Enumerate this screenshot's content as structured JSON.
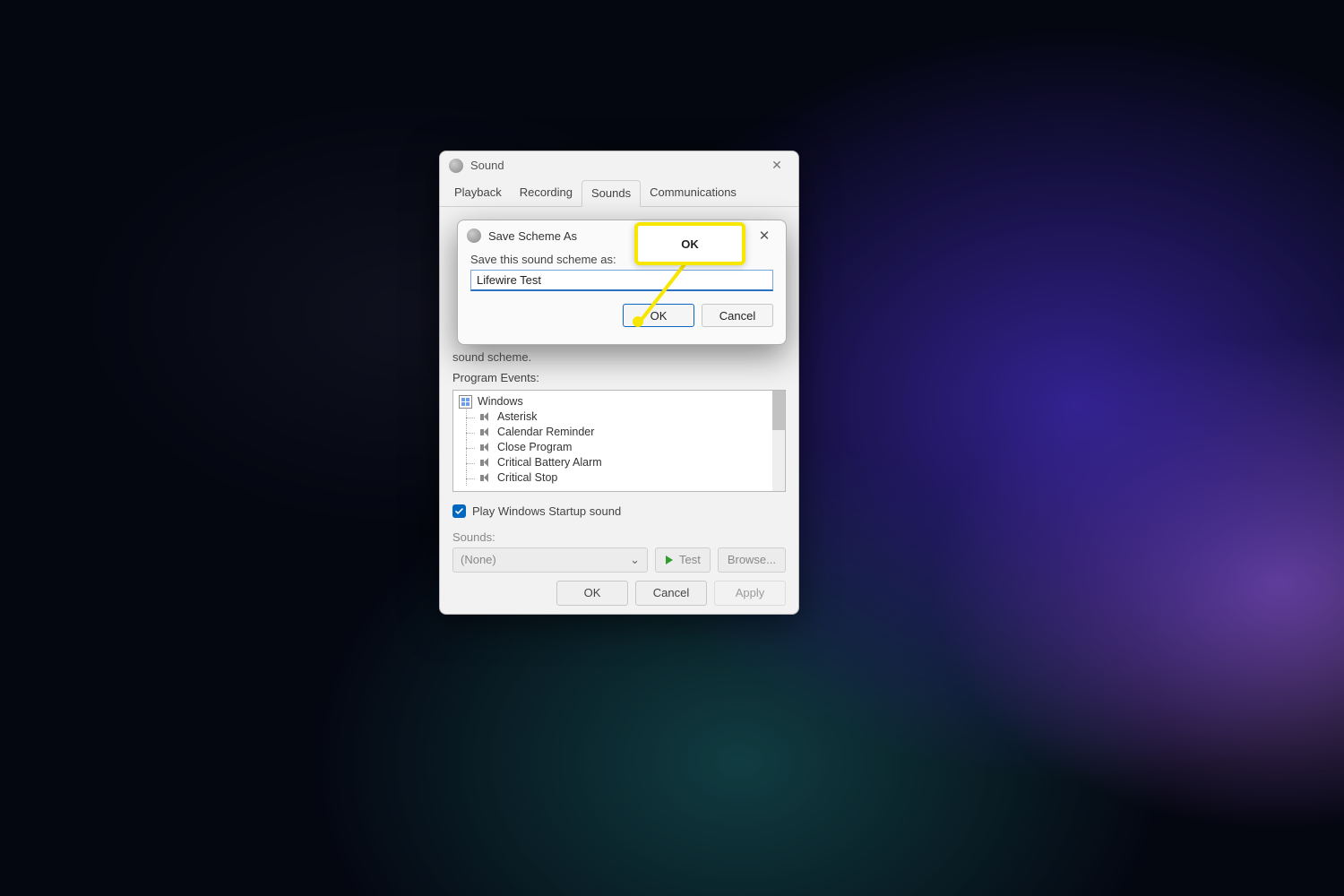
{
  "sound_window": {
    "title": "Sound",
    "tabs": [
      "Playback",
      "Recording",
      "Sounds",
      "Communications"
    ],
    "active_tab": "Sounds",
    "truncated_text": "sound scheme.",
    "program_events_label": "Program Events:",
    "events_root": "Windows",
    "events": [
      "Asterisk",
      "Calendar Reminder",
      "Close Program",
      "Critical Battery Alarm",
      "Critical Stop"
    ],
    "startup_checkbox": {
      "checked": true,
      "label": "Play Windows Startup sound"
    },
    "sounds_section": {
      "label": "Sounds:",
      "combo_value": "(None)",
      "test_label": "Test",
      "browse_label": "Browse..."
    },
    "buttons": {
      "ok": "OK",
      "cancel": "Cancel",
      "apply": "Apply"
    }
  },
  "save_scheme_modal": {
    "title": "Save Scheme As",
    "prompt": "Save this sound scheme as:",
    "input_value": "Lifewire Test",
    "ok": "OK",
    "cancel": "Cancel"
  },
  "callout": {
    "label": "OK"
  }
}
